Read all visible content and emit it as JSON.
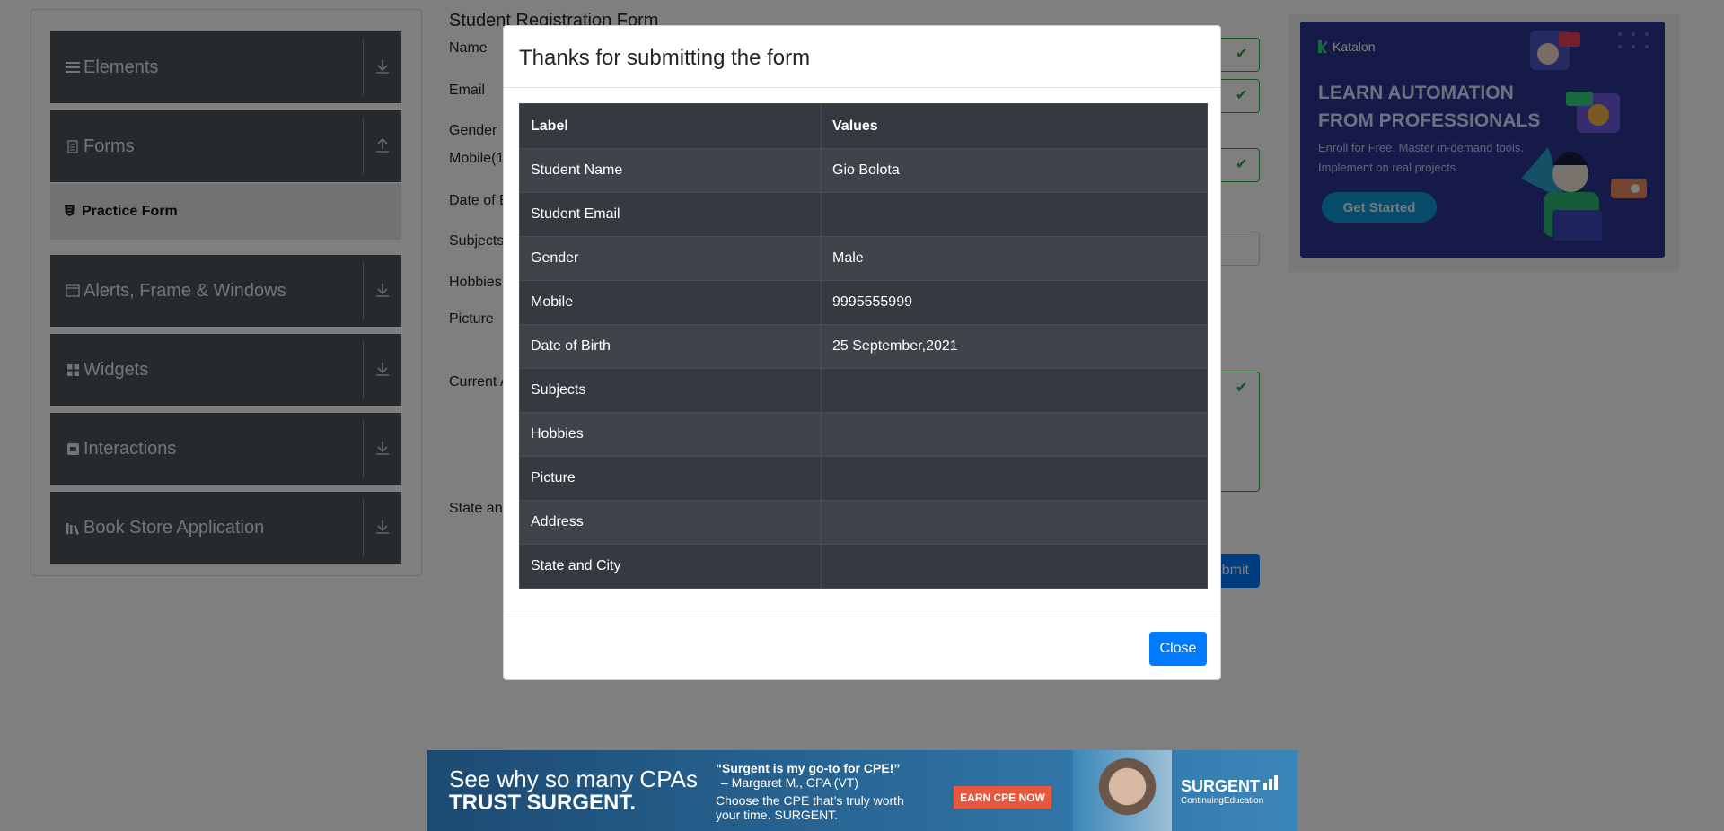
{
  "sidebar": {
    "groups": [
      {
        "label": "Elements",
        "icon": "list-icon",
        "arrow": "download-icon"
      },
      {
        "label": "Forms",
        "icon": "document-icon",
        "arrow": "upload-icon"
      },
      {
        "label": "Alerts, Frame & Windows",
        "icon": "window-icon",
        "arrow": "download-icon"
      },
      {
        "label": "Widgets",
        "icon": "widgets-icon",
        "arrow": "download-icon"
      },
      {
        "label": "Interactions",
        "icon": "interaction-icon",
        "arrow": "download-icon"
      },
      {
        "label": "Book Store Application",
        "icon": "books-icon",
        "arrow": "download-icon"
      }
    ],
    "active_item": {
      "label": "Practice Form",
      "icon": "html5-icon"
    }
  },
  "form": {
    "title": "Student Registration Form",
    "labels": {
      "name": "Name",
      "email": "Email",
      "gender": "Gender",
      "mobile": "Mobile(1",
      "dob": "Date of B",
      "subjects": "Subjects",
      "hobbies": "Hobbies",
      "picture": "Picture",
      "address": "Current A",
      "state": "State and"
    },
    "submit_label": "bmit"
  },
  "modal": {
    "title": "Thanks for submitting the form",
    "table": {
      "headers": [
        "Label",
        "Values"
      ],
      "rows": [
        [
          "Student Name",
          "Gio Bolota"
        ],
        [
          "Student Email",
          ""
        ],
        [
          "Gender",
          "Male"
        ],
        [
          "Mobile",
          "9995555999"
        ],
        [
          "Date of Birth",
          "25 September,2021"
        ],
        [
          "Subjects",
          ""
        ],
        [
          "Hobbies",
          ""
        ],
        [
          "Picture",
          ""
        ],
        [
          "Address",
          ""
        ],
        [
          "State and City",
          ""
        ]
      ]
    },
    "close_label": "Close"
  },
  "ad_right": {
    "brand": "Katalon",
    "headline": "LEARN AUTOMATION FROM PROFESSIONALS",
    "subtext": "Enroll for Free. Master in-demand tools. Implement on real projects.",
    "cta": "Get Started"
  },
  "ad_bottom": {
    "line1": "See why so many CPAs",
    "line2": "TRUST SURGENT.",
    "quote": "“Surgent is my go-to for CPE!”",
    "attribution": "– Margaret M., CPA (VT)",
    "tagline": "Choose the CPE that’s truly worth your time. SURGENT.",
    "cta": "EARN CPE NOW",
    "logo": "SURGENT",
    "logo_sub": "ContinuingEducation"
  },
  "colors": {
    "sidebar_header": "#4f555a",
    "table_dark": "#343a40",
    "table_striped": "#3e444a",
    "primary": "#007bff",
    "valid": "#28a745",
    "ad_right_bg": "#2c3592",
    "ad_bottom_cta": "#e7573e"
  }
}
